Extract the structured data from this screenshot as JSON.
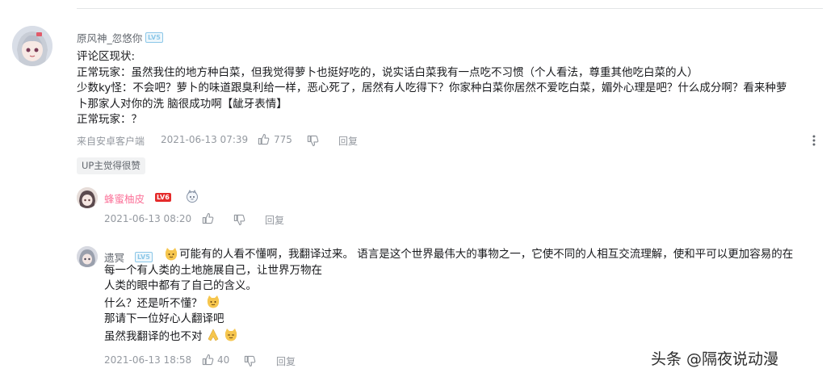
{
  "comment": {
    "username": "原风神_忽悠你",
    "level": "LV5",
    "lines": [
      "评论区现状:",
      "正常玩家：虽然我住的地方种白菜，但我觉得萝卜也挺好吃的，说实话白菜我有一点吃不习惯（个人看法，尊重其他吃白菜的人）",
      "少数ky怪：不会吧？萝卜的味道跟臭利给一样，恶心死了，居然有人吃得下？你家种白菜你居然不爱吃白菜，媚外心理是吧？什么成分啊？看来种萝",
      "卜那家人对你的洗 脑很成功啊【龇牙表情】",
      "正常玩家：？"
    ],
    "source": "来自安卓客户端",
    "time": "2021-06-13 07:39",
    "likes": "775",
    "reply_label": "回复",
    "up_chip": "UP主觉得很赞"
  },
  "reply1": {
    "username": "蜂蜜柚皮",
    "level": "LV6",
    "time": "2021-06-13 08:20",
    "reply_label": "回复"
  },
  "reply2": {
    "username": "遗冥",
    "level": "LV5",
    "line1": "可能有的人看不懂啊，我翻译过来。 语言是这个世界最伟大的事物之一，它使不同的人相互交流理解，使和平可以更加容易的在",
    "line2": "每一个有人类的土地施展自己，让世界万物在",
    "line3": "人类的眼中都有了自己的含义。",
    "line4": "什么？还是听不懂？",
    "line5": "那请下一位好心人翻译吧",
    "line6": "虽然我翻译的也不对",
    "time": "2021-06-13 18:58",
    "likes": "40",
    "reply_label": "回复"
  },
  "watermark": "头条 @隔夜说动漫",
  "colors": {
    "pink_name": "#fb7299",
    "grey_text": "#9499a0",
    "lv5": "#8cc7e8",
    "lv6": "#e52b2b",
    "emoji_yellow": "#f6c64e"
  }
}
